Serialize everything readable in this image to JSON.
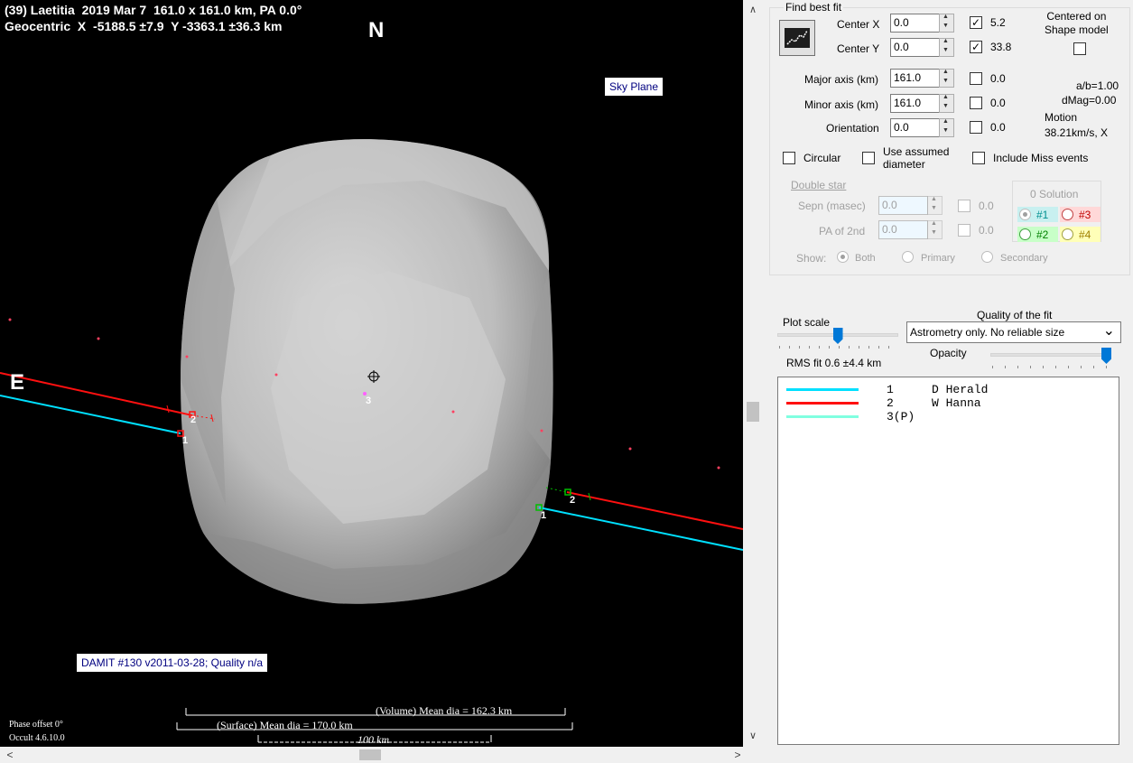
{
  "plot": {
    "header_line1": "(39) Laetitia  2019 Mar 7  161.0 x 161.0 km, PA 0.0°",
    "header_line2": "Geocentric  X  -5188.5 ±7.9  Y -3363.1 ±36.3 km",
    "north_label": "N",
    "east_label": "E",
    "sky_plane_button": "Sky Plane",
    "shape_model_label": "DAMIT #130 v2011-03-28; Quality n/a",
    "chord_labels": [
      "1",
      "2",
      "3",
      "1",
      "2"
    ],
    "scale": {
      "volume_text": "(Volume) Mean dia = 162.3 km",
      "surface_text": "(Surface) Mean dia = 170.0 km",
      "km_text": "100 km"
    },
    "phase_offset": "Phase offset 0°",
    "version": "Occult 4.6.10.0",
    "colors": {
      "chord1": "#00e0ff",
      "chord2": "#ff1010",
      "chord3": "#80ffe0",
      "background": "#000000"
    }
  },
  "panel": {
    "find_best_fit_title": "Find best fit",
    "center_x_label": "Center X",
    "center_x_value": "0.0",
    "center_x_fit": "5.2",
    "center_y_label": "Center Y",
    "center_y_value": "0.0",
    "center_y_fit": "33.8",
    "centered_label": "Centered on\nShape model",
    "major_axis_label": "Major axis (km)",
    "major_axis_value": "161.0",
    "major_axis_fit": "0.0",
    "minor_axis_label": "Minor axis (km)",
    "minor_axis_value": "161.0",
    "minor_axis_fit": "0.0",
    "orientation_label": "Orientation",
    "orientation_value": "0.0",
    "orientation_fit": "0.0",
    "ab_ratio": "a/b=1.00",
    "dmag": "dMag=0.00",
    "motion_label": "Motion",
    "motion_value": "38.21km/s, X",
    "circular_label": "Circular",
    "assumed_diameter_label": "Use assumed\ndiameter",
    "include_miss_label": "Include Miss events",
    "double_star_label": "Double star",
    "sepn_label": "Sepn (masec)",
    "sepn_value": "0.0",
    "sepn_fit": "0.0",
    "pa2_label": "PA of 2nd",
    "pa2_value": "0.0",
    "pa2_fit": "0.0",
    "show_label": "Show:",
    "show_both": "Both",
    "show_primary": "Primary",
    "show_secondary": "Secondary",
    "solution_title": "0 Solution",
    "sol1": "#1",
    "sol2": "#2",
    "sol3": "#3",
    "sol4": "#4",
    "plot_scale_label": "Plot scale",
    "quality_label": "Quality of the fit",
    "quality_value": "Astrometry only. No reliable size",
    "opacity_label": "Opacity",
    "rms_fit": "RMS fit 0.6 ±4.4 km",
    "plot_scale_level": 0.5,
    "opacity_level": 1.0
  },
  "legend": [
    {
      "num": "1",
      "name": "D Herald",
      "color": "#00e0ff"
    },
    {
      "num": "2",
      "name": "W Hanna",
      "color": "#ff1010"
    },
    {
      "num": "3(P)",
      "name": "",
      "color": "#80ffe0"
    }
  ]
}
